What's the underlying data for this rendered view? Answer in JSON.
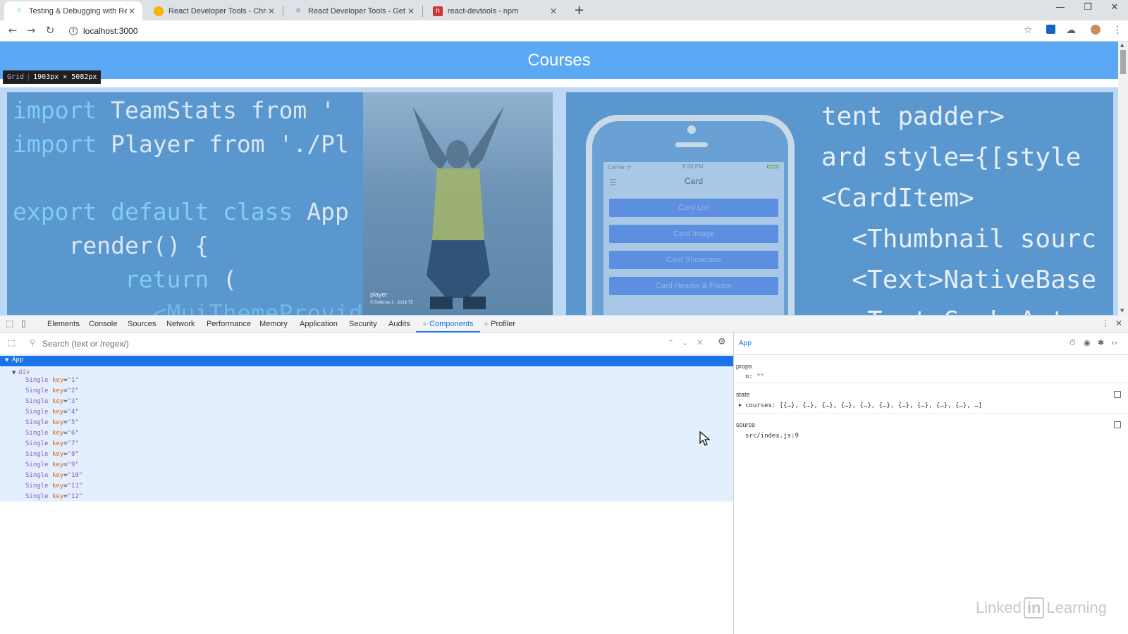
{
  "browser": {
    "tabs": [
      {
        "title": "Testing & Debugging with React",
        "icon": "react-logo-icon",
        "active": true
      },
      {
        "title": "React Developer Tools - Chrome",
        "icon": "chrome-web-store-icon",
        "active": false
      },
      {
        "title": "React Developer Tools - Get this",
        "icon": "react-logo-icon",
        "active": false
      },
      {
        "title": "react-devtools - npm",
        "icon": "npm-icon",
        "active": false
      }
    ],
    "url": "localhost:3000"
  },
  "page": {
    "header_title": "Courses",
    "grid_badge": {
      "label": "Grid",
      "size": "1903px × 5082px"
    },
    "card1_code": [
      {
        "kw": "import",
        "rest": " TeamStats from '"
      },
      {
        "kw": "import",
        "rest": " Player from './Pl"
      },
      {
        "kw": "",
        "rest": ""
      },
      {
        "kw": "export default class",
        "rest": " App"
      },
      {
        "kw": "",
        "rest": "    render() {"
      },
      {
        "kw": "        return",
        "rest": " ("
      },
      {
        "kw": "          <MuiThemeProvide",
        "rest": ""
      }
    ],
    "card1_caption": "player",
    "card1_caption_sub": "© Defense 1 · 2016 TE",
    "card2_code": [
      "tent padder>",
      "ard style={[style",
      "<CardItem>",
      "  <Thumbnail sourc",
      "  <Text>NativeBase",
      "  <Text>GeekyAnts"
    ],
    "phone": {
      "carrier": "Carrier ᯤ",
      "time": "6:30 PM",
      "title": "Card",
      "buttons": [
        "Card List",
        "Card Image",
        "Card Showcase",
        "Card Header & Footer"
      ]
    }
  },
  "devtools": {
    "tabs": [
      "Elements",
      "Console",
      "Sources",
      "Network",
      "Performance",
      "Memory",
      "Application",
      "Security",
      "Audits",
      "Components",
      "Profiler"
    ],
    "active_tab": "Components",
    "search_placeholder": "Search (text or /regex/)",
    "tree": {
      "root": "App",
      "child": "div",
      "items": [
        {
          "name": "Single",
          "key": "\"1\""
        },
        {
          "name": "Single",
          "key": "\"2\""
        },
        {
          "name": "Single",
          "key": "\"3\""
        },
        {
          "name": "Single",
          "key": "\"4\""
        },
        {
          "name": "Single",
          "key": "\"5\""
        },
        {
          "name": "Single",
          "key": "\"6\""
        },
        {
          "name": "Single",
          "key": "\"7\""
        },
        {
          "name": "Single",
          "key": "\"8\""
        },
        {
          "name": "Single",
          "key": "\"9\""
        },
        {
          "name": "Single",
          "key": "\"10\""
        },
        {
          "name": "Single",
          "key": "\"11\""
        },
        {
          "name": "Single",
          "key": "\"12\""
        }
      ]
    },
    "side": {
      "title": "App",
      "props_title": "props",
      "props_line": "n: \"\"",
      "state_title": "state",
      "state_line": "courses: [{…}, {…}, {…}, {…}, {…}, {…}, {…}, {…}, {…}, {…}, …]",
      "source_title": "source",
      "source_line": "src/index.js:9"
    }
  },
  "watermark": {
    "left": "Linked",
    "box": "in",
    "right": "Learning"
  },
  "colors": {
    "header_blue": "#5ba8f5",
    "devtools_accent": "#1a73e8",
    "tree_highlight": "#e3effc"
  }
}
